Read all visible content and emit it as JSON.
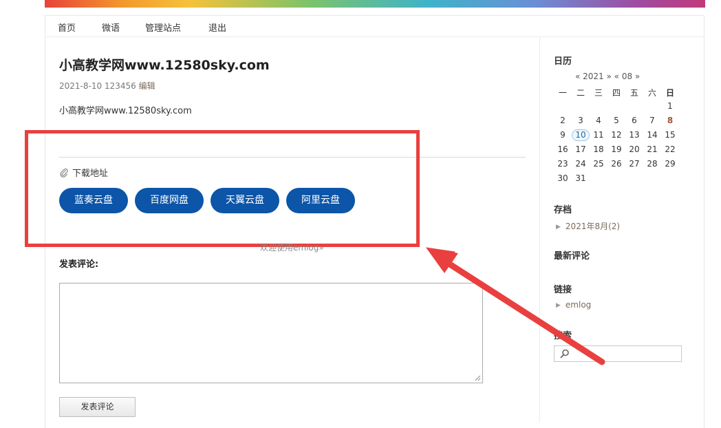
{
  "nav": {
    "items": [
      "首页",
      "微语",
      "管理站点",
      "退出"
    ]
  },
  "post": {
    "title": "小高教学网www.12580sky.com",
    "meta": "2021-8-10 123456",
    "edit": "编辑",
    "body": "小高教学网www.12580sky.com",
    "download_label": "下载地址",
    "buttons": [
      "蓝奏云盘",
      "百度网盘",
      "天翼云盘",
      "阿里云盘"
    ],
    "button_color": "#0c55a8"
  },
  "welcome": "欢迎使用emlog»",
  "comment": {
    "label": "发表评论:",
    "textarea_value": "",
    "submit": "发表评论"
  },
  "sidebar": {
    "calendar_title": "日历",
    "calendar_nav": "« 2021 » « 08 »",
    "weekdays": [
      "一",
      "二",
      "三",
      "四",
      "五",
      "六",
      "日"
    ],
    "rows": [
      [
        "",
        "",
        "",
        "",
        "",
        "",
        "1"
      ],
      [
        "2",
        "3",
        "4",
        "5",
        "6",
        "7",
        "8"
      ],
      [
        "9",
        "10",
        "11",
        "12",
        "13",
        "14",
        "15"
      ],
      [
        "16",
        "17",
        "18",
        "19",
        "20",
        "21",
        "22"
      ],
      [
        "23",
        "24",
        "25",
        "26",
        "27",
        "28",
        "29"
      ],
      [
        "30",
        "31",
        "",
        "",
        "",
        "",
        ""
      ]
    ],
    "today": "10",
    "linked_day": "8",
    "archive_title": "存档",
    "archive_items": [
      "2021年8月(2)"
    ],
    "recent_comments_title": "最新评论",
    "links_title": "链接",
    "links_items": [
      "emlog"
    ],
    "search_title": "搜索",
    "search_value": ""
  },
  "annotation_color": "#e9403f",
  "icons": [
    "paperclip-icon",
    "search-icon",
    "chevron-right-icon"
  ]
}
